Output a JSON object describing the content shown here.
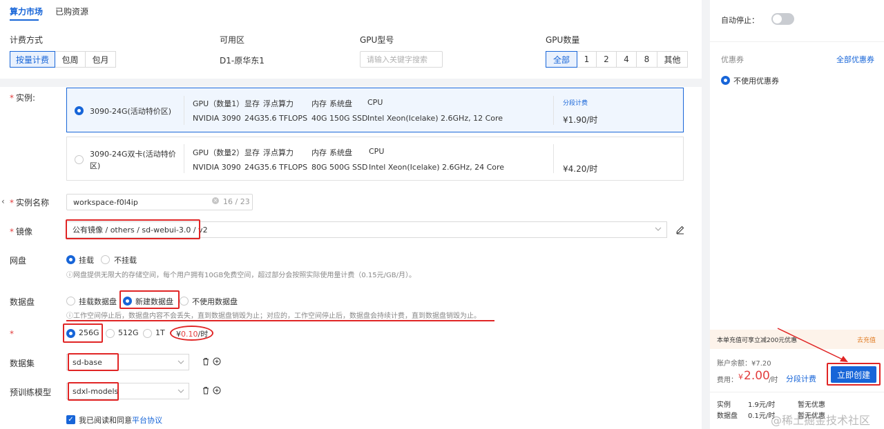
{
  "tabs": [
    "算力市场",
    "已购资源"
  ],
  "billing": {
    "label": "计费方式",
    "options": [
      "按量计费",
      "包周",
      "包月"
    ],
    "selected": "按量计费"
  },
  "zone": {
    "label": "可用区",
    "value": "D1-原华东1"
  },
  "gpu_model": {
    "label": "GPU型号",
    "placeholder": "请输入关键字搜索"
  },
  "gpu_count": {
    "label": "GPU数量",
    "options": [
      "全部",
      "1",
      "2",
      "4",
      "8",
      "其他"
    ],
    "selected": "全部"
  },
  "instance": {
    "label": "实例:",
    "cards": [
      {
        "name": "3090-24G(活动特价区)",
        "gpu_header": "GPU（数量1）",
        "vram_header": "显存",
        "flops_header": "浮点算力",
        "mem_header": "内存",
        "disk_header": "系统盘",
        "cpu_header": "CPU",
        "gpu": "NVIDIA 3090",
        "vram": "24G",
        "flops": "35.6 TFLOPS",
        "mem": "40G",
        "disk": "150G SSD",
        "cpu": "Intel Xeon(Icelake) 2.6GHz, 12 Core",
        "price_label": "分段计费",
        "price": "¥1.90/时",
        "selected": true
      },
      {
        "name": "3090-24G双卡(活动特价区)",
        "gpu_header": "GPU（数量2）",
        "vram_header": "显存",
        "flops_header": "浮点算力",
        "mem_header": "内存",
        "disk_header": "系统盘",
        "cpu_header": "CPU",
        "gpu": "NVIDIA 3090",
        "vram": "24G",
        "flops": "35.6 TFLOPS",
        "mem": "80G",
        "disk": "500G SSD",
        "cpu": "Intel Xeon(Icelake) 2.6GHz, 24 Core",
        "price": "¥4.20/时",
        "selected": false
      }
    ]
  },
  "instance_name": {
    "label": "实例名称",
    "value": "workspace-f0l4ip",
    "count": "16 / 23"
  },
  "image": {
    "label": "镜像",
    "value": "公有镜像 / others / sd-webui-3.0 / v2"
  },
  "netdisk": {
    "label": "网盘",
    "options": [
      "挂载",
      "不挂载"
    ],
    "selected": "挂载",
    "hint": "ⓘ网盘提供无限大的存储空间，每个用户拥有10GB免费空间，超过部分会按照实际使用量计费（0.15元/GB/月）。"
  },
  "datadisk": {
    "label": "数据盘",
    "options": [
      "挂载数据盘",
      "新建数据盘",
      "不使用数据盘"
    ],
    "selected": "新建数据盘",
    "hint": "ⓘ工作空间停止后，数据盘内容不会丢失，直到数据盘销毁为止；对应的，工作空间停止后，数据盘会持续计费，直到数据盘销毁为止。"
  },
  "disk_size": {
    "options": [
      "256G",
      "512G",
      "1T"
    ],
    "selected": "256G",
    "price_prefix": "¥",
    "price_value": "0.10",
    "price_suffix": "/时"
  },
  "dataset": {
    "label": "数据集",
    "value": "sd-base"
  },
  "pretrained": {
    "label": "预训练模型",
    "value": "sdxl-models"
  },
  "agreement": {
    "text": "我已阅读和同意",
    "link": "平台协议"
  },
  "sidebar": {
    "autostop_label": "自动停止：",
    "coupon_label": "优惠券",
    "coupon_link": "全部优惠券",
    "coupon_option": "不使用优惠券",
    "promo_text": "本单充值可享立减200元优惠",
    "promo_link": "去充值",
    "balance": "账户余额：¥7.20",
    "fee_label": "费用：",
    "fee_currency": "¥",
    "fee_amount": "2.00",
    "fee_unit": "/时",
    "fee_link": "分段计费",
    "create_button": "立即创建",
    "breakdown": [
      {
        "name": "实例",
        "price": "1.9元/时",
        "discount": "暂无优惠"
      },
      {
        "name": "数据盘",
        "price": "0.1元/时",
        "discount": "暂无优惠"
      }
    ]
  },
  "watermark": "@稀土掘金技术社区",
  "colors": {
    "accent": "#1765d8",
    "annotation_red": "#e02424",
    "price_red": "#e23d3d"
  }
}
